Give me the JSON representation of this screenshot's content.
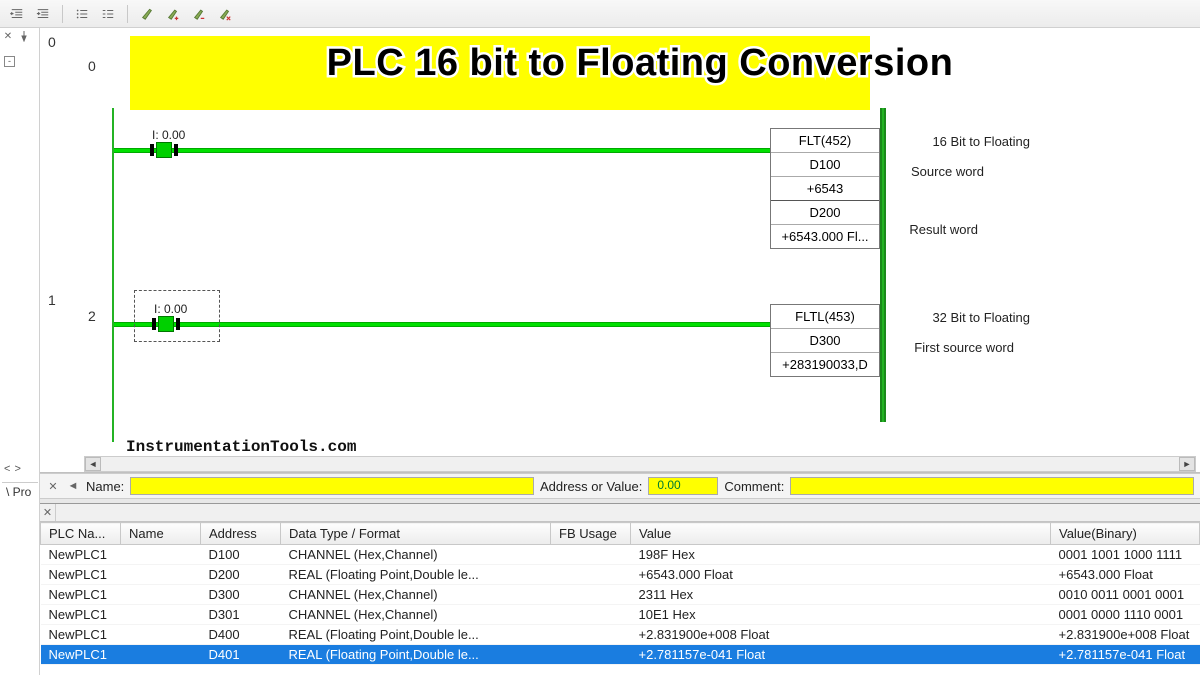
{
  "overlay": {
    "title": "PLC 16 bit to Floating Conversion",
    "site": "InstrumentationTools.com"
  },
  "toolbar": {
    "icons": [
      "outdent",
      "indent",
      "list-bullets",
      "list-lines",
      "brush",
      "brush-add",
      "brush-remove",
      "brush-x"
    ]
  },
  "gutter": {
    "nav_left": "<",
    "nav_right": ">",
    "tab": "Pro",
    "toggle": "-"
  },
  "ladder": {
    "col0": "0",
    "rung0_num": "0",
    "rung1_num_a": "1",
    "rung1_num_b": "2",
    "contact0_label": "I: 0.00",
    "contact1_label": "I: 0.00",
    "instr1": {
      "op": "FLT(452)",
      "src": "D100",
      "const": "+6543",
      "dst": "D200",
      "live": "+6543.000 Fl...",
      "c1": "16 Bit to Floating",
      "c2": "Source word",
      "c3": "Result word"
    },
    "instr2": {
      "op": "FLTL(453)",
      "src": "D300",
      "live": "+283190033,D",
      "c1": "32 Bit to Floating",
      "c2": "First source word"
    }
  },
  "editbar": {
    "name_label": "Name:",
    "name_value": "",
    "addr_label": "Address or Value:",
    "addr_value": "0.00",
    "comment_label": "Comment:",
    "comment_value": ""
  },
  "watch": {
    "headers": {
      "plc": "PLC Na...",
      "name": "Name",
      "addr": "Address",
      "type": "Data Type / Format",
      "fb": "FB Usage",
      "val": "Value",
      "bin": "Value(Binary)"
    },
    "rows": [
      {
        "plc": "NewPLC1",
        "name": "",
        "addr": "D100",
        "type": "CHANNEL (Hex,Channel)",
        "fb": "",
        "val": "198F Hex",
        "bin": "0001 1001 1000 1111",
        "sel": false
      },
      {
        "plc": "NewPLC1",
        "name": "",
        "addr": "D200",
        "type": "REAL (Floating Point,Double le...",
        "fb": "",
        "val": "+6543.000 Float",
        "bin": "+6543.000 Float",
        "sel": false
      },
      {
        "plc": "NewPLC1",
        "name": "",
        "addr": "D300",
        "type": "CHANNEL (Hex,Channel)",
        "fb": "",
        "val": "2311 Hex",
        "bin": "0010 0011 0001 0001",
        "sel": false
      },
      {
        "plc": "NewPLC1",
        "name": "",
        "addr": "D301",
        "type": "CHANNEL (Hex,Channel)",
        "fb": "",
        "val": "10E1 Hex",
        "bin": "0001 0000 1110 0001",
        "sel": false
      },
      {
        "plc": "NewPLC1",
        "name": "",
        "addr": "D400",
        "type": "REAL (Floating Point,Double le...",
        "fb": "",
        "val": "+2.831900e+008 Float",
        "bin": "+2.831900e+008 Float",
        "sel": false
      },
      {
        "plc": "NewPLC1",
        "name": "",
        "addr": "D401",
        "type": "REAL (Floating Point,Double le...",
        "fb": "",
        "val": "+2.781157e-041 Float",
        "bin": "+2.781157e-041 Float",
        "sel": true
      }
    ]
  }
}
